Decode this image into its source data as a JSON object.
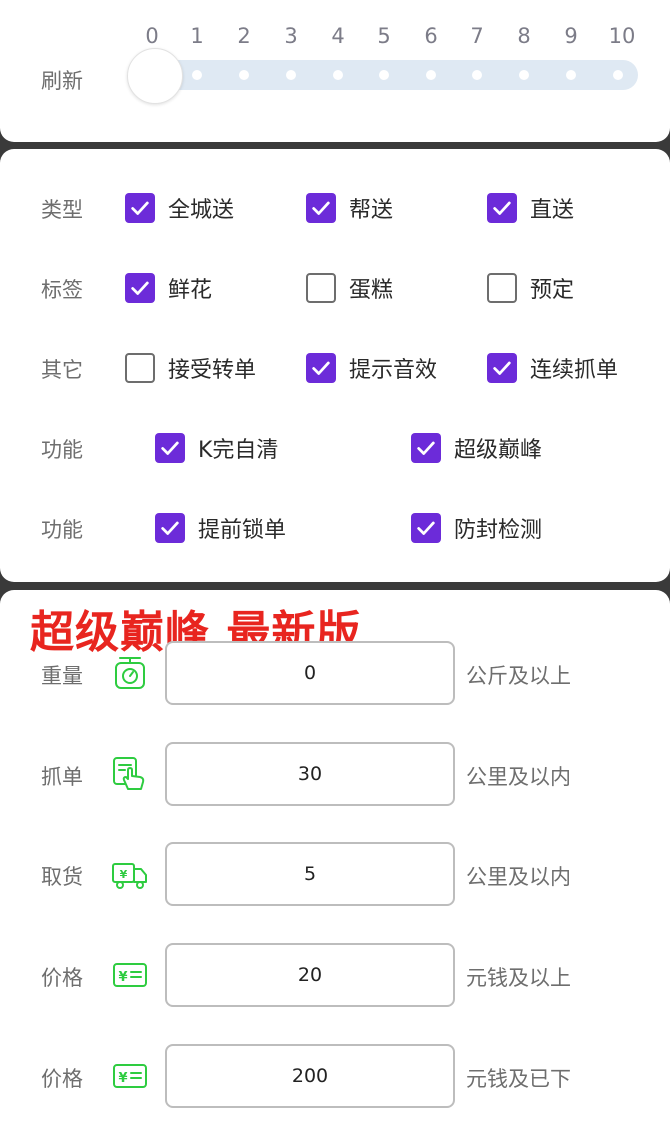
{
  "slider": {
    "label": "刷新",
    "ticks": [
      "0",
      "1",
      "2",
      "3",
      "4",
      "5",
      "6",
      "7",
      "8",
      "9",
      "10"
    ],
    "value": 0
  },
  "options": {
    "type": {
      "label": "类型",
      "items": [
        {
          "label": "全城送",
          "checked": true
        },
        {
          "label": "帮送",
          "checked": true
        },
        {
          "label": "直送",
          "checked": true
        }
      ]
    },
    "tags": {
      "label": "标签",
      "items": [
        {
          "label": "鲜花",
          "checked": true
        },
        {
          "label": "蛋糕",
          "checked": false
        },
        {
          "label": "预定",
          "checked": false
        }
      ]
    },
    "other": {
      "label": "其它",
      "items": [
        {
          "label": "接受转单",
          "checked": false
        },
        {
          "label": "提示音效",
          "checked": true
        },
        {
          "label": "连续抓单",
          "checked": true
        }
      ]
    },
    "func1": {
      "label": "功能",
      "items": [
        {
          "label": "K完自清",
          "checked": true
        },
        {
          "label": "超级巅峰",
          "checked": true
        }
      ]
    },
    "func2": {
      "label": "功能",
      "items": [
        {
          "label": "提前锁单",
          "checked": true
        },
        {
          "label": "防封检测",
          "checked": true
        }
      ]
    }
  },
  "overlay_text": "超级巅峰 最新版",
  "inputs": [
    {
      "label": "重量",
      "icon": "scale-icon",
      "value": "0",
      "unit": "公斤及以上"
    },
    {
      "label": "抓单",
      "icon": "tap-icon",
      "value": "30",
      "unit": "公里及以内"
    },
    {
      "label": "取货",
      "icon": "truck-icon",
      "value": "5",
      "unit": "公里及以内"
    },
    {
      "label": "价格",
      "icon": "price-icon",
      "value": "20",
      "unit": "元钱及以上"
    },
    {
      "label": "价格",
      "icon": "price-icon",
      "value": "200",
      "unit": "元钱及已下"
    }
  ],
  "colors": {
    "accent": "#6c2bd9",
    "icon_green": "#2ecc40",
    "overlay_red": "#e8251f"
  }
}
